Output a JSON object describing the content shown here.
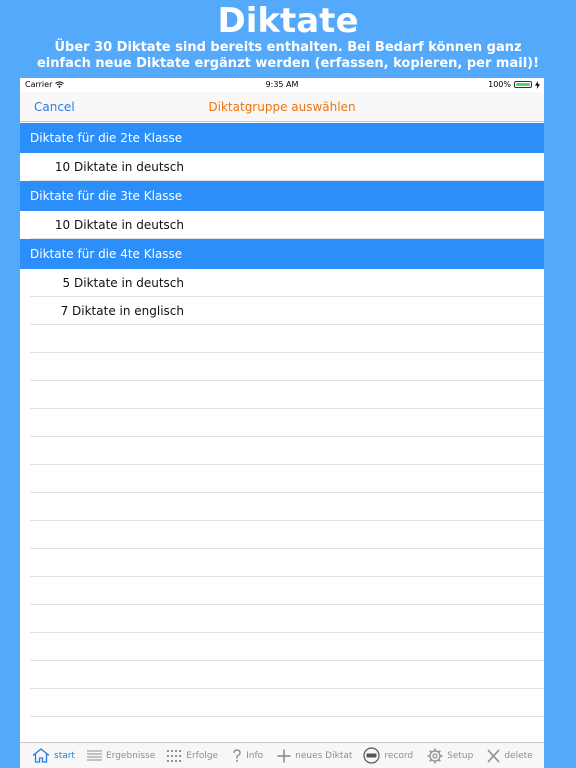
{
  "promo": {
    "title": "Diktate",
    "subtitle": "Über 30 Diktate sind bereits enthalten. Bei Bedarf können ganz einfach neue Diktate ergänzt werden (erfassen, kopieren, per mail)!"
  },
  "status": {
    "carrier": "Carrier",
    "time": "9:35 AM",
    "battery": "100%",
    "battery_level": 1.0
  },
  "navbar": {
    "cancel": "Cancel",
    "title": "Diktatgruppe auswählen"
  },
  "groups": [
    {
      "header": "Diktate für die 2te Klasse",
      "items": [
        "10 Diktate in deutsch"
      ]
    },
    {
      "header": "Diktate für die 3te Klasse",
      "items": [
        "10 Diktate in deutsch"
      ]
    },
    {
      "header": "Diktate für die 4te Klasse",
      "items": [
        "5 Diktate in deutsch",
        "7 Diktate in englisch"
      ]
    }
  ],
  "tabbar": {
    "start": "start",
    "results": "Ergebnisse",
    "success": "Erfolge",
    "info": "Info",
    "new": "neues Diktat",
    "record": "record",
    "setup": "Setup",
    "delete": "delete"
  },
  "colors": {
    "background": "#55a9fb",
    "group_header": "#2c8ef8",
    "nav_title": "#f0730a",
    "accent": "#2a7de1"
  }
}
